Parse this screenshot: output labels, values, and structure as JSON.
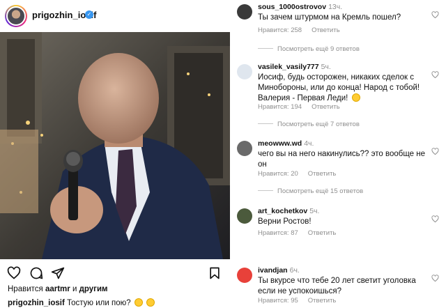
{
  "post": {
    "username": "prigozhin_iosif",
    "liked_by_prefix": "Нравится ",
    "liked_by_user": "aartmr",
    "liked_by_and": " и ",
    "liked_by_others": "другим",
    "caption_user": "prigozhin_iosif",
    "caption_text": " Тостую или пою?",
    "icons": [
      "heart-outline-icon",
      "comment-icon",
      "share-icon",
      "bookmark-icon"
    ]
  },
  "comments": [
    {
      "user": "sous_1000ostrovov",
      "time": "13ч.",
      "text": "Ты зачем штурмом на Кремль пошел?",
      "likes": "Нравится: 258",
      "reply": "Ответить",
      "more": "Посмотреть ещё 9 ответов"
    },
    {
      "user": "vasilek_vasily777",
      "time": "5ч.",
      "text": "Иосиф, будь осторожен, никаких сделок с Минобороны, или до конца! Народ с тобой! Валерия - Первая Леди!",
      "likes": "Нравится: 194",
      "reply": "Ответить",
      "more": "Посмотреть ещё 7 ответов"
    },
    {
      "user": "meowww.wd",
      "time": "4ч.",
      "text": "чего вы на него накинулись?? это вообще не он",
      "likes": "Нравится: 20",
      "reply": "Ответить",
      "more": "Посмотреть ещё 15 ответов"
    },
    {
      "user": "art_kochetkov",
      "time": "5ч.",
      "text": "Верни Ростов!",
      "likes": "Нравится: 87",
      "reply": "Ответить"
    },
    {
      "user": "ivandjan",
      "time": "6ч.",
      "text": "Ты вкурсе что тебе 20 лет светит уголовка если не успокоишься?",
      "likes": "Нравится: 95",
      "reply": "Ответить"
    }
  ],
  "colors": {
    "muted": "#8e8e8e",
    "verified": "#3897f0",
    "ivandjan_avatar": "#e8413a"
  }
}
